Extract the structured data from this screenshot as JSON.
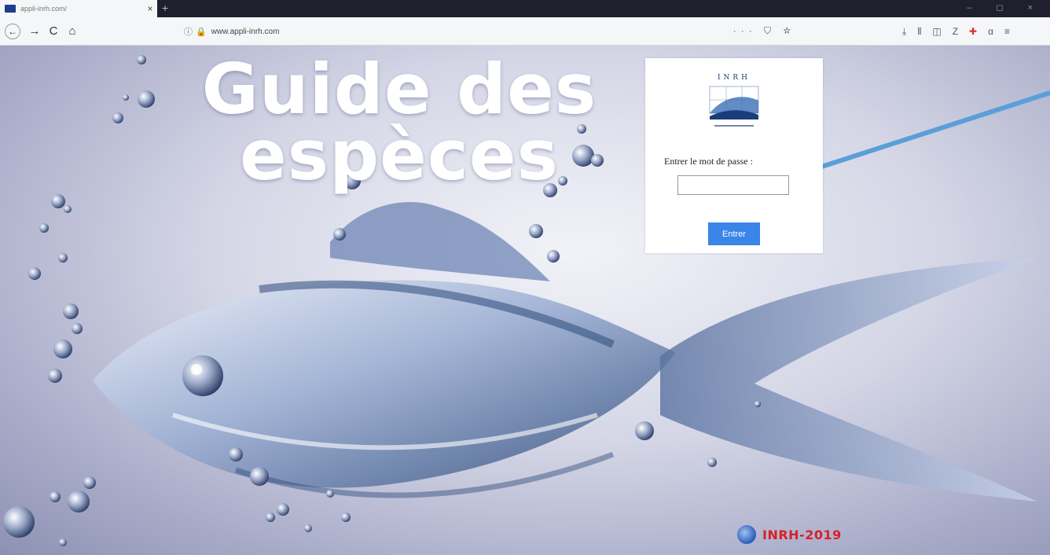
{
  "browser": {
    "tab_title": "appli-inrh.com/",
    "tab_close": "×",
    "new_tab": "+",
    "window_controls": "– ◻ ×",
    "nav": {
      "back": "←",
      "forward": "→",
      "reload": "C",
      "home": "⌂"
    },
    "url_info": "ⓘ",
    "url_lock": "🔒",
    "url": "www.appli-inrh.com",
    "url_actions": "··· ⛉ ☆",
    "toolbar": {
      "download": "⤓",
      "library": "⫴",
      "sidebar": "◫",
      "zotero": "Z",
      "extension": "✚",
      "reader": "α",
      "menu": "≡"
    },
    "colors": {
      "tab_bar": "#1f1f2e",
      "nav_bar": "#f5f6f7"
    }
  },
  "hero": {
    "line1": "Guide des",
    "line2": "espèces"
  },
  "login": {
    "logo_text": "INRH",
    "label": "Entrer le mot de passe :",
    "password_value": "",
    "submit_label": "Entrer"
  },
  "footer": {
    "brand": "INRH-2019"
  },
  "colors": {
    "submit_button": "#3b84e8",
    "brand_red": "#d8202a",
    "arrow": "#5a9fd8"
  }
}
